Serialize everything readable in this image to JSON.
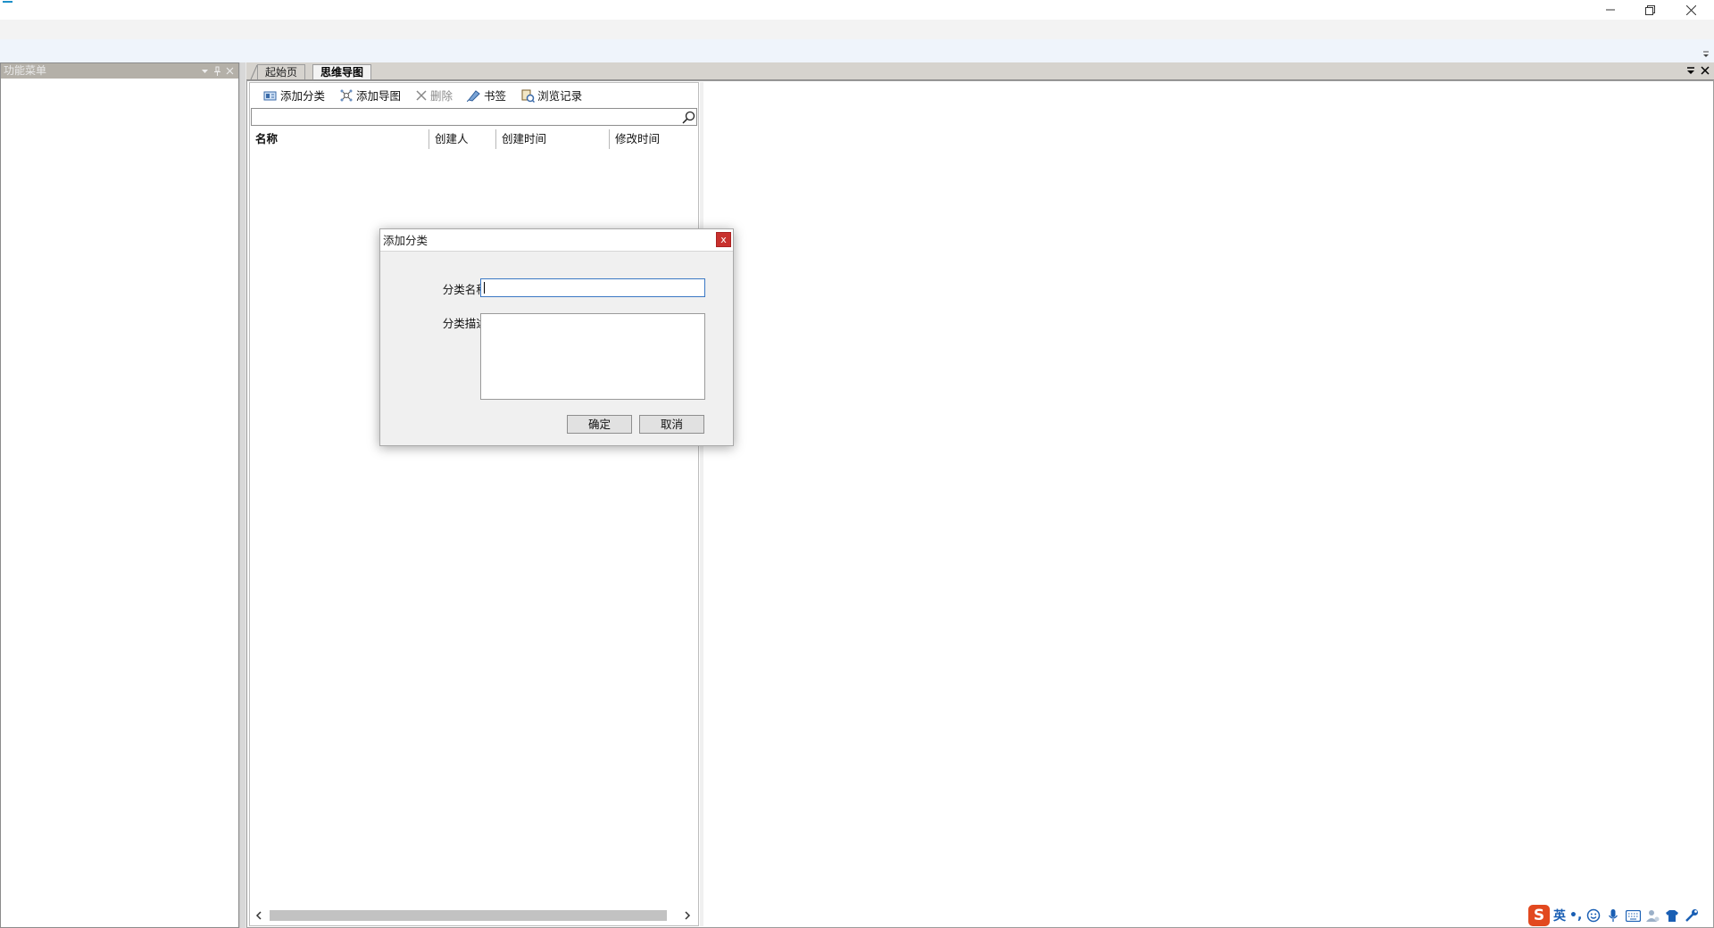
{
  "window": {
    "controls": {
      "minimize": "minimize",
      "restore": "restore",
      "close": "close"
    }
  },
  "left_panel": {
    "title": "功能菜单"
  },
  "doc_tabs": [
    {
      "label": "起始页"
    },
    {
      "label": "思维导图"
    }
  ],
  "toolbar": {
    "add_category": "添加分类",
    "add_map": "添加导图",
    "delete": "删除",
    "bookmark": "书签",
    "history": "浏览记录"
  },
  "search": {
    "value": "",
    "placeholder": ""
  },
  "list": {
    "columns": [
      "名称",
      "创建人",
      "创建时间",
      "修改时间"
    ]
  },
  "dialog": {
    "title": "添加分类",
    "close_glyph": "x",
    "name_label": "分类名称:",
    "name_value": "",
    "desc_label": "分类描述:",
    "desc_value": "",
    "ok_label": "确定",
    "cancel_label": "取消"
  },
  "ime": {
    "logo": "S",
    "mode": "英",
    "punct": "•,"
  },
  "colors": {
    "accent": "#1e90c8",
    "dialog_close": "#c8312d",
    "ime_brand": "#e2491f",
    "panel_header": "#b4b0a8"
  }
}
